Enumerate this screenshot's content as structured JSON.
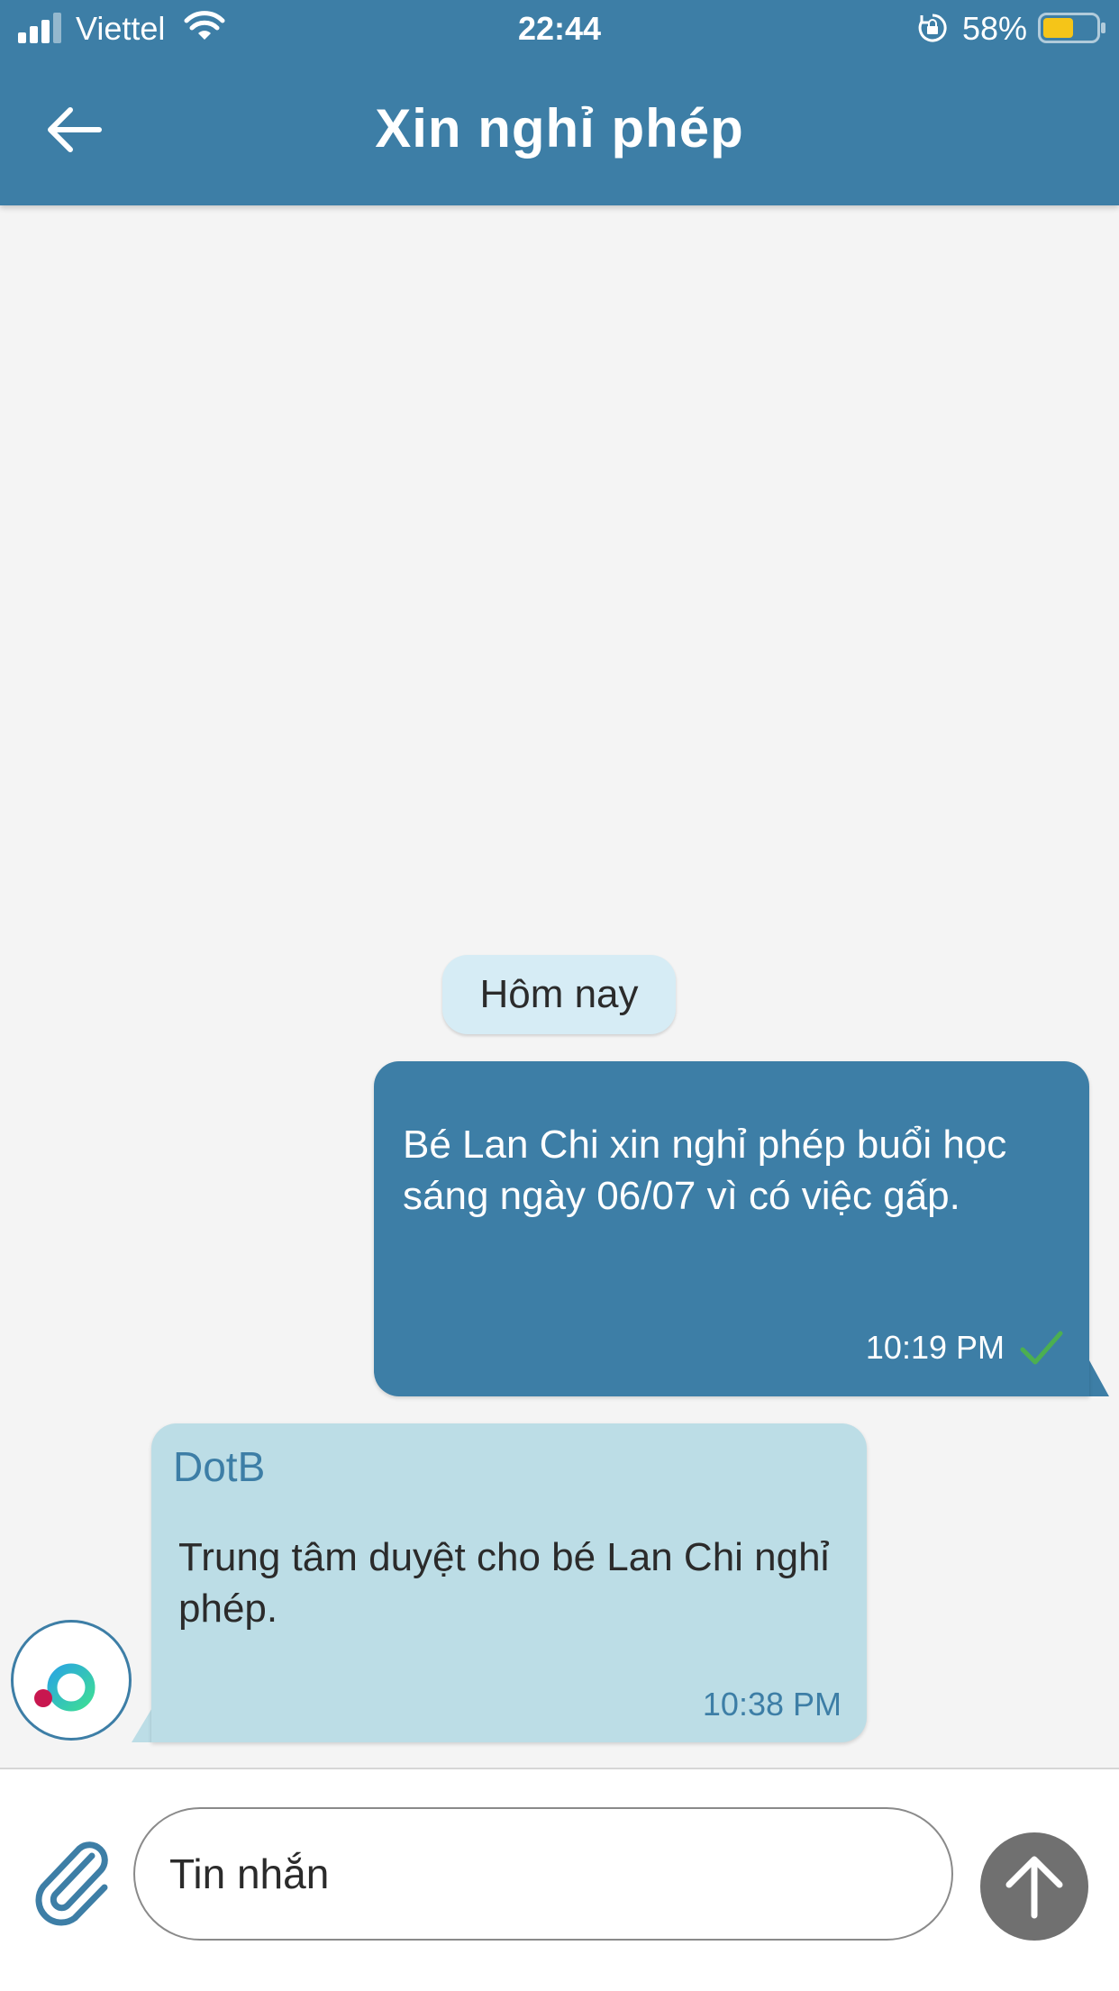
{
  "status_bar": {
    "carrier": "Viettel",
    "time": "22:44",
    "battery": "58%",
    "battery_level": 0.58,
    "icons": [
      "signal-icon",
      "wifi-icon",
      "rotation-lock-icon",
      "battery-icon"
    ]
  },
  "header": {
    "title": "Xin nghỉ phép",
    "back_icon": "arrow-left-icon"
  },
  "conversation": {
    "date_label": "Hôm nay",
    "messages": [
      {
        "direction": "outgoing",
        "text": "Bé Lan Chi xin nghỉ phép buổi học sáng ngày 06/07 vì có việc gấp.",
        "time": "10:19 PM",
        "status_icon": "check-icon"
      },
      {
        "direction": "incoming",
        "sender": "DotB",
        "text": "Trung tâm duyệt cho bé Lan Chi nghỉ phép.",
        "time": "10:38 PM",
        "avatar_icon": "dotb-logo-icon"
      }
    ]
  },
  "composer": {
    "placeholder": "Tin nhắn",
    "attach_icon": "paperclip-icon",
    "send_icon": "arrow-up-icon"
  },
  "colors": {
    "primary": "#3d7ea6",
    "background": "#f4f4f4",
    "incoming_bubble": "#bcdde6",
    "date_chip": "#d6ecf5",
    "send_button": "#707070",
    "check": "#4caf50",
    "battery_fill": "#f5c518"
  }
}
